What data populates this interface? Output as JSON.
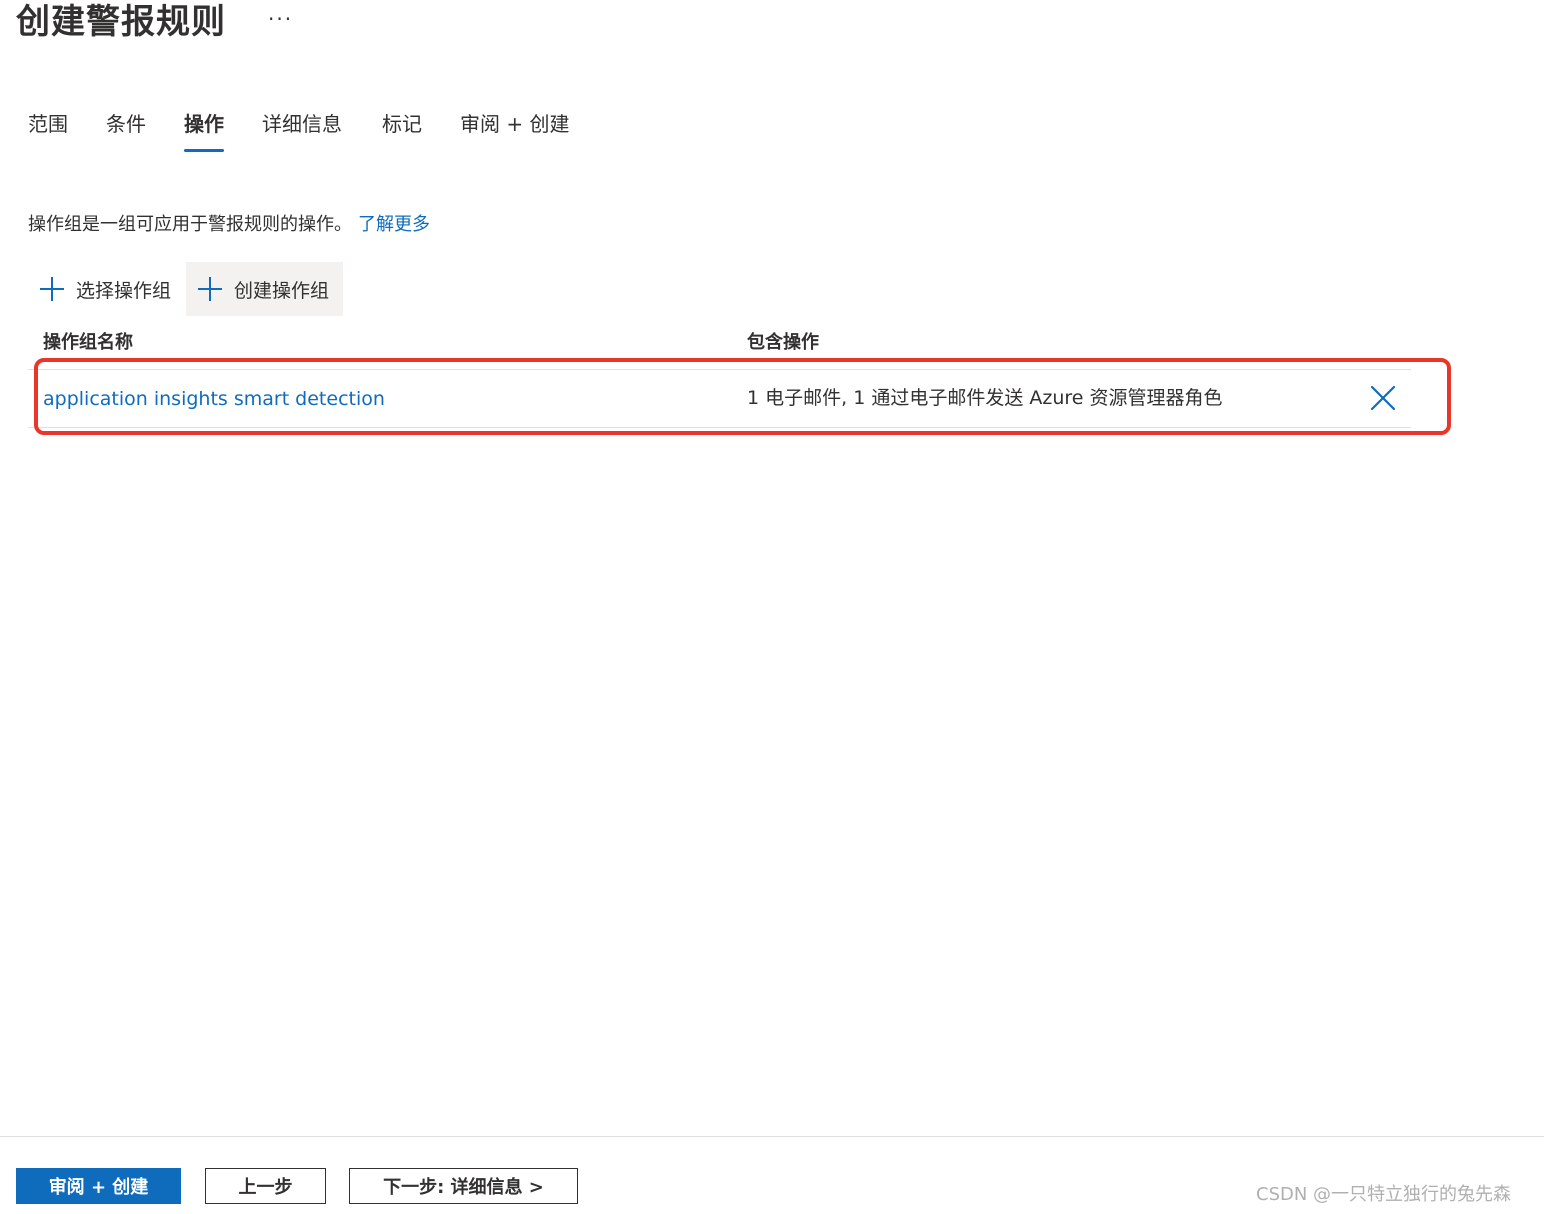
{
  "header": {
    "title": "创建警报规则",
    "more_label": "···"
  },
  "tabs": [
    {
      "label": "范围",
      "active": false
    },
    {
      "label": "条件",
      "active": false
    },
    {
      "label": "操作",
      "active": true
    },
    {
      "label": "详细信息",
      "active": false
    },
    {
      "label": "标记",
      "active": false
    },
    {
      "label": "审阅 + 创建",
      "active": false
    }
  ],
  "description": {
    "text": "操作组是一组可应用于警报规则的操作。",
    "link": "了解更多"
  },
  "commands": {
    "select_group": "选择操作组",
    "create_group": "创建操作组",
    "icon": "plus-icon"
  },
  "table": {
    "columns": [
      "操作组名称",
      "包含操作"
    ],
    "rows": [
      {
        "name": "application insights smart detection",
        "actions": "1 电子邮件, 1 通过电子邮件发送 Azure 资源管理器角色",
        "remove_icon": "close-icon"
      }
    ]
  },
  "footer": {
    "review_create": "审阅 + 创建",
    "previous": "上一步",
    "next": "下一步: 详细信息 >"
  },
  "watermark": "CSDN @一只特立独行的兔先森",
  "colors": {
    "accent": "#0f6cbd",
    "highlight": "#e8372a",
    "text": "#323130",
    "divider": "#e1dfdd"
  }
}
